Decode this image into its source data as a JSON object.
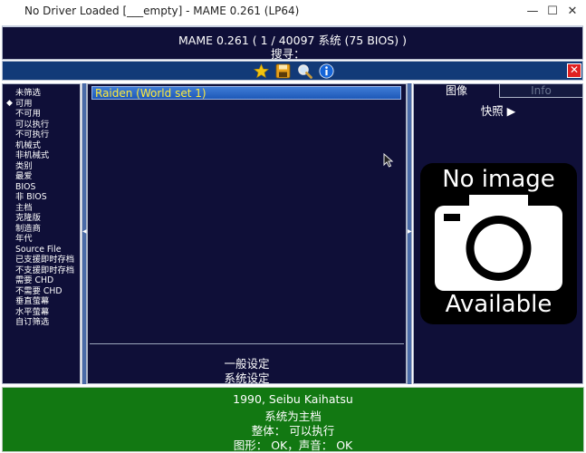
{
  "window": {
    "title": "No Driver Loaded [___empty] - MAME 0.261 (LP64)",
    "minimize": "—",
    "maximize": "☐",
    "close": "✕"
  },
  "header": {
    "version_line": "MAME 0.261 ( 1 / 40097 系统 (75 BIOS) )",
    "search_line": "搜寻： _"
  },
  "toolbar": {
    "icons": [
      "star-icon",
      "save-icon",
      "search-icon",
      "info-icon"
    ],
    "close_label": "✕",
    "accent": "#123a78"
  },
  "filters": {
    "selected_marker": "◆",
    "items": [
      "未筛选",
      "可用",
      "不可用",
      "可以执行",
      "不可执行",
      "机械式",
      "非机械式",
      "类别",
      "最爱",
      "BIOS",
      "非 BIOS",
      "主档",
      "克隆版",
      "制造商",
      "年代",
      "Source File",
      "已支援即时存档",
      "不支援即时存档",
      "需要 CHD",
      "不需要 CHD",
      "垂直萤幕",
      "水平萤幕",
      "自订筛选"
    ],
    "selected_index": 1
  },
  "gamelist": {
    "items": [
      "Raiden (World set 1)"
    ]
  },
  "center_menu": {
    "general_settings": "一般设定",
    "system_settings": "系统设定"
  },
  "right_panel": {
    "tab_image": "图像",
    "tab_info": "Info",
    "snapshot_label": "快照 ▶",
    "no_image_top": "No image",
    "no_image_bottom": "Available"
  },
  "status": {
    "line1": "1990, Seibu Kaihatsu",
    "line2": "系统为主档",
    "line3": "整体：  可以执行",
    "line4": "图形：  OK，声音：  OK",
    "color": "#127812"
  }
}
